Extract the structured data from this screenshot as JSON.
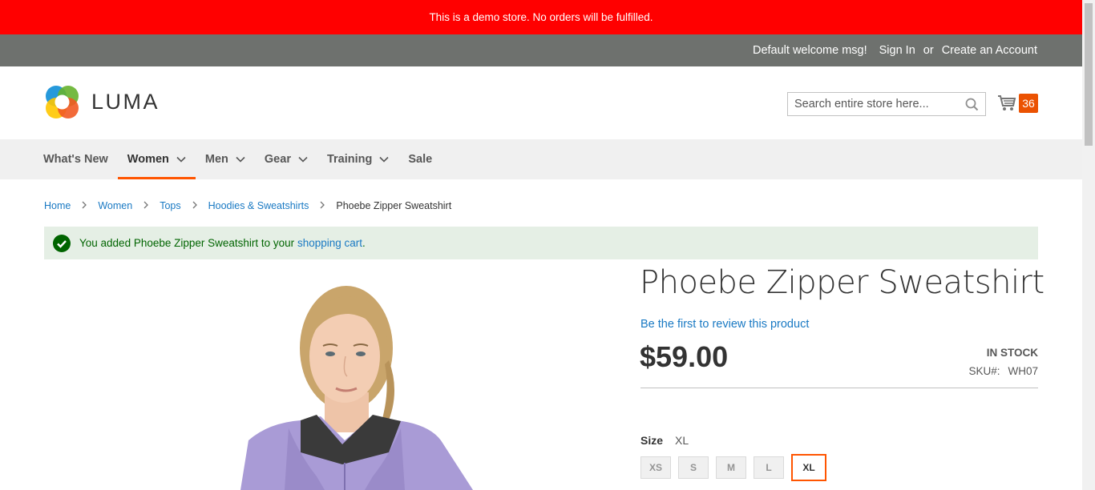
{
  "demo_notice": "This is a demo store. No orders will be fulfilled.",
  "header_links": {
    "welcome": "Default welcome msg!",
    "sign_in": "Sign In",
    "or": "or",
    "create_account": "Create an Account"
  },
  "logo": {
    "text": "LUMA"
  },
  "search": {
    "placeholder": "Search entire store here...",
    "value": ""
  },
  "cart": {
    "count": "36"
  },
  "nav": {
    "items": [
      {
        "label": "What's New",
        "has_dropdown": false
      },
      {
        "label": "Women",
        "has_dropdown": true,
        "active": true
      },
      {
        "label": "Men",
        "has_dropdown": true
      },
      {
        "label": "Gear",
        "has_dropdown": true
      },
      {
        "label": "Training",
        "has_dropdown": true
      },
      {
        "label": "Sale",
        "has_dropdown": false
      }
    ]
  },
  "breadcrumbs": [
    "Home",
    "Women",
    "Tops",
    "Hoodies & Sweatshirts",
    "Phoebe Zipper Sweatshirt"
  ],
  "message": {
    "prefix": "You added Phoebe Zipper Sweatshirt to your ",
    "link": "shopping cart",
    "suffix": "."
  },
  "product": {
    "title": "Phoebe Zipper Sweatshirt",
    "review_link": "Be the first to review this product",
    "price": "$59.00",
    "stock": "IN STOCK",
    "sku_label": "SKU#:",
    "sku": "WH07",
    "size_label": "Size",
    "size_selected": "XL",
    "sizes": [
      "XS",
      "S",
      "M",
      "L",
      "XL"
    ]
  },
  "colors": {
    "demo_bar": "#ff0000",
    "header_bar": "#6e716e",
    "accent": "#ff5501",
    "link": "#1979c3",
    "success_bg": "#e5efe5",
    "success_text": "#006400",
    "cart_counter": "#eb5202"
  }
}
